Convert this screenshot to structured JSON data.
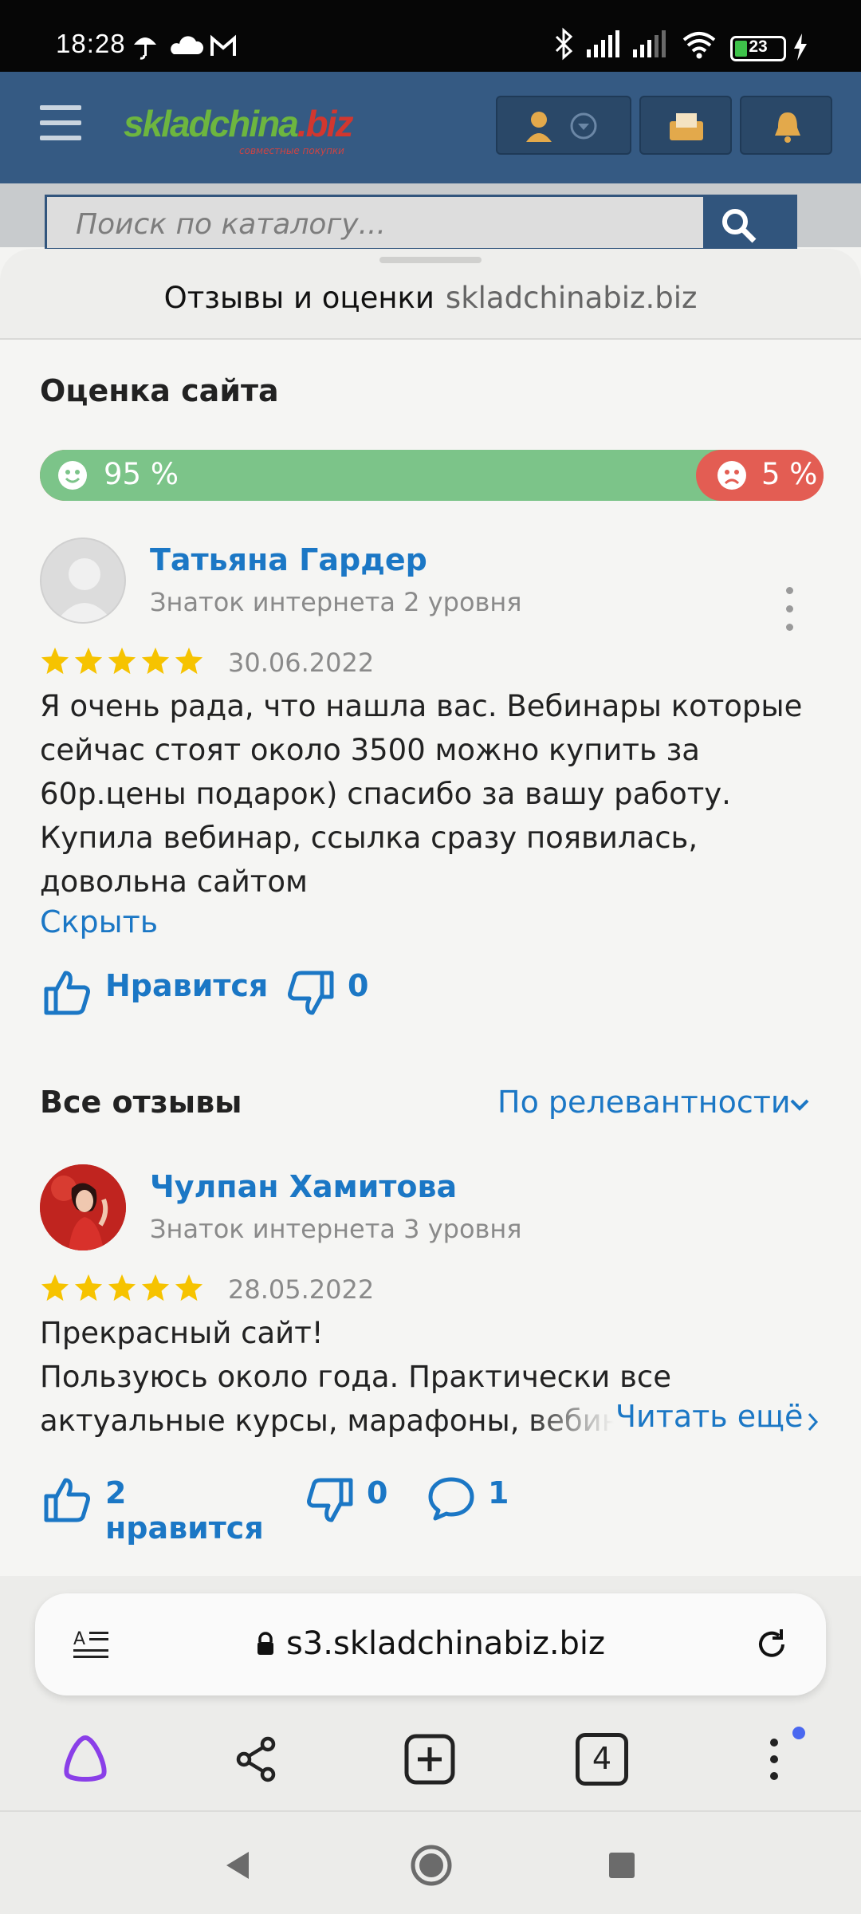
{
  "status_bar": {
    "time": "18:28",
    "battery": "23",
    "battery_fraction": 0.23
  },
  "site": {
    "logo": "skladchina",
    "logo_tld": ".biz",
    "logo_tagline": "совместные покупки",
    "search_placeholder": "Поиск по каталогу..."
  },
  "sheet": {
    "title": "Отзывы и оценки",
    "domain": "skladchinabiz.biz",
    "site_rating_heading": "Оценка сайта",
    "rating": {
      "positive_label": "95 %",
      "negative_label": "5 %",
      "positive_fraction": 0.95,
      "negative_fraction": 0.05
    },
    "featured_review": {
      "author": "Татьяна Гардер",
      "level": "Знаток интернета 2 уровня",
      "stars": 5,
      "date": "30.06.2022",
      "text": "Я очень рада, что нашла вас. Вебинары которые сейчас стоят около 3500 можно купить за 60р.цены подарок) спасибо за вашу работу. Купила вебинар, ссылка сразу появилась, довольна сайтом",
      "collapse_label": "Скрыть",
      "like_label": "Нравится",
      "dislike_count": "0"
    },
    "all_reviews_heading": "Все отзывы",
    "sort_label": "По релевантности",
    "second_review": {
      "author": "Чулпан Хамитова",
      "level": "Знаток интернета 3 уровня",
      "stars": 5,
      "date": "28.05.2022",
      "line1": "Прекрасный сайт!",
      "line2": "Пользуюсь около года. Практически все",
      "line3": "актуальные курсы, марафоны, вебина",
      "read_more_label": "Читать ещё",
      "like_label": "2 нравится",
      "dislike_count": "0",
      "comment_count": "1"
    }
  },
  "browser": {
    "url": "s3.skladchinabiz.biz",
    "tabs_count": "4"
  },
  "colors": {
    "accent_blue": "#1b77c5",
    "positive_green": "#7cc489",
    "negative_red": "#e35d53",
    "star_yellow": "#f6c300",
    "site_header_blue": "#355a83",
    "alice_purple": "#8a3fe8"
  }
}
